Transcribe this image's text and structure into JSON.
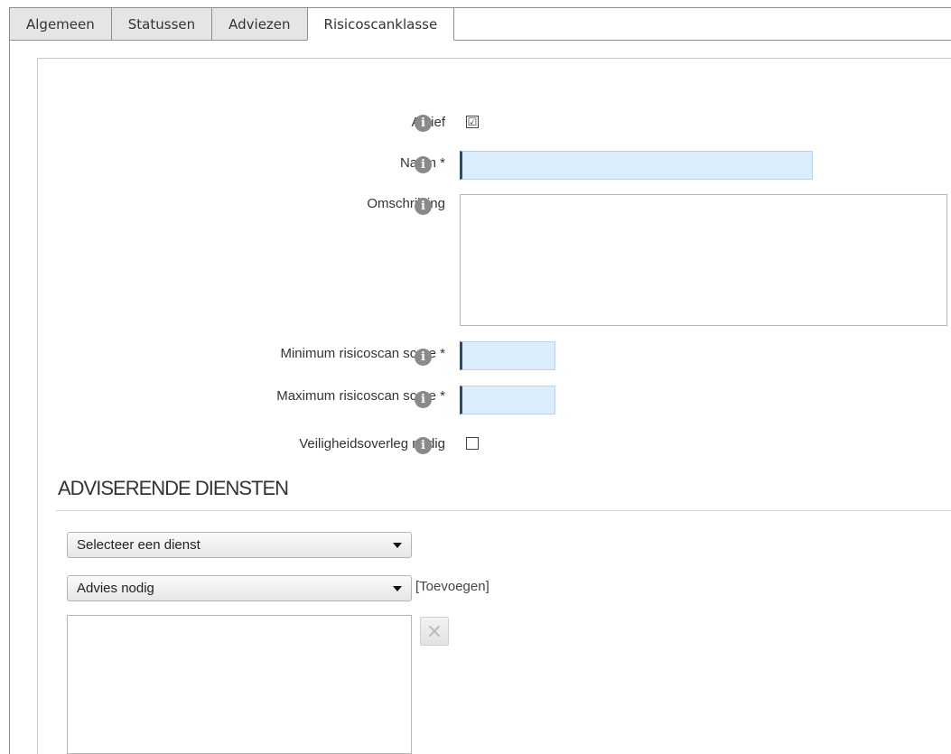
{
  "tabs": [
    {
      "label": "Algemeen"
    },
    {
      "label": "Statussen"
    },
    {
      "label": "Adviezen"
    },
    {
      "label": "Risicoscanklasse",
      "active": true
    }
  ],
  "form": {
    "actief_label": "Actief",
    "actief_checked": true,
    "naam_label": "Naam *",
    "naam_value": "",
    "omschrijving_label": "Omschrijving",
    "omschrijving_value": "",
    "min_label": "Minimum risicoscan score *",
    "min_value": "",
    "max_label": "Maximum risicoscan score *",
    "max_value": "",
    "overleg_label": "Veiligheidsoverleg nodig",
    "overleg_checked": false,
    "check_mark": "☑"
  },
  "section": {
    "title": "ADVISERENDE DIENSTEN",
    "dienst_select": "Selecteer een dienst",
    "advies_select": "Advies nodig",
    "add_link": "[Toevoegen]",
    "remove_label": "×"
  },
  "icons": {
    "info": "i"
  },
  "colors": {
    "input_bg": "#dceefd",
    "input_accent": "#2e4b6e",
    "info_icon": "#8a8a8a"
  }
}
